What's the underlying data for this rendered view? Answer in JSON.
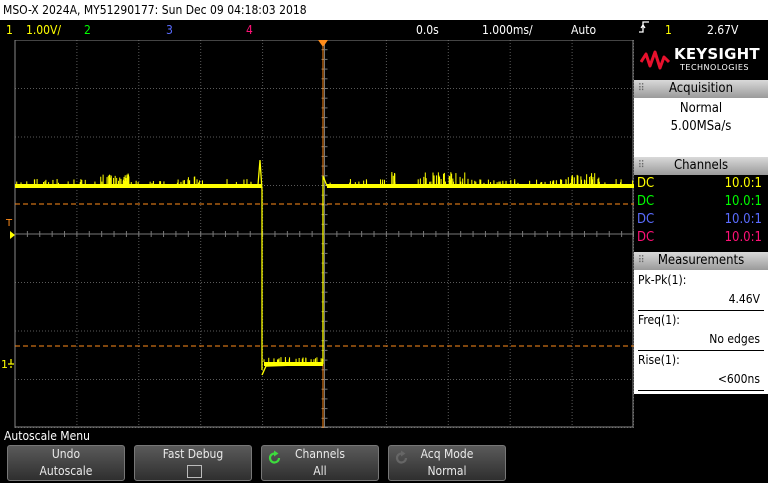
{
  "title_bar": "MSO-X 2024A, MY51290177: Sun Dec 09 04:18:03 2018",
  "status": {
    "ch1_num": "1",
    "ch1_scale": "1.00V/",
    "ch2_num": "2",
    "ch3_num": "3",
    "ch4_num": "4",
    "time_pos": "0.0s",
    "time_scale": "1.000ms/",
    "trig_mode": "Auto",
    "trig_icon": "trigger-edge-icon",
    "trig_src": "1",
    "trig_level": "2.67V"
  },
  "colors": {
    "ch1": "#ffff00",
    "ch2": "#00ff00",
    "ch3": "#5a6cff",
    "ch4": "#ff1177",
    "trigger": "#ff8c1a",
    "grid": "#5a5a5a",
    "brand_red": "#e8112d"
  },
  "screen_markers": {
    "trigger_marker": "T",
    "ground_marker": "1"
  },
  "logo": {
    "line1": "KEYSIGHT",
    "line2": "TECHNOLOGIES"
  },
  "acquisition": {
    "header": "Acquisition",
    "mode": "Normal",
    "rate": "5.00MSa/s"
  },
  "channels": {
    "header": "Channels",
    "rows": [
      {
        "coupling": "DC",
        "probe": "10.0:1"
      },
      {
        "coupling": "DC",
        "probe": "10.0:1"
      },
      {
        "coupling": "DC",
        "probe": "10.0:1"
      },
      {
        "coupling": "DC",
        "probe": "10.0:1"
      }
    ]
  },
  "measurements": {
    "header": "Measurements",
    "items": [
      {
        "label": "Pk-Pk(1):",
        "value": "4.46V"
      },
      {
        "label": "Freq(1):",
        "value": "No edges"
      },
      {
        "label": "Rise(1):",
        "value": "<600ns"
      }
    ]
  },
  "menu": {
    "title": "Autoscale Menu",
    "softkeys": [
      {
        "line1": "Undo",
        "line2": "Autoscale"
      },
      {
        "line1": "Fast Debug",
        "line2": ""
      },
      {
        "line1": "Channels",
        "line2": "All"
      },
      {
        "line1": "Acq Mode",
        "line2": "Normal"
      }
    ]
  }
}
